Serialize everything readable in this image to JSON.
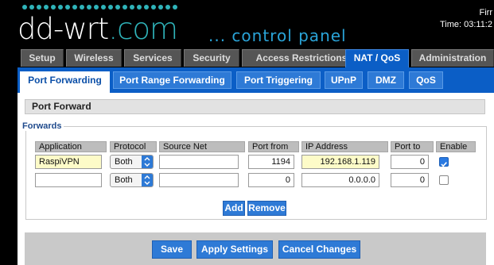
{
  "header": {
    "logo_main": "dd-wrt",
    "logo_suffix": ".com",
    "subtitle": "... control panel",
    "firmware_label": "Firr",
    "time_label": "Time: 03:11:2"
  },
  "colors": {
    "accent": "#0b5ec6",
    "header_bg": "#000000",
    "dot_teal": "#2fb3b9",
    "highlight_input": "#fdfbc8"
  },
  "main_tabs": [
    {
      "label": "Setup"
    },
    {
      "label": "Wireless"
    },
    {
      "label": "Services"
    },
    {
      "label": "Security"
    },
    {
      "label": "Access Restrictions"
    },
    {
      "label": "NAT / QoS",
      "active": true
    },
    {
      "label": "Administration"
    }
  ],
  "sub_tabs": [
    {
      "label": "Port Forwarding",
      "active": true
    },
    {
      "label": "Port Range Forwarding"
    },
    {
      "label": "Port Triggering"
    },
    {
      "label": "UPnP"
    },
    {
      "label": "DMZ"
    },
    {
      "label": "QoS"
    }
  ],
  "section": {
    "title": "Port Forward",
    "legend": "Forwards"
  },
  "table": {
    "headers": [
      "Application",
      "Protocol",
      "Source Net",
      "Port from",
      "IP Address",
      "Port to",
      "Enable"
    ],
    "rows": [
      {
        "application": "RaspiVPN",
        "protocol": "Both",
        "source_net": "",
        "port_from": "1194",
        "ip_address": "192.168.1.119",
        "port_to": "0",
        "enabled": true
      },
      {
        "application": "",
        "protocol": "Both",
        "source_net": "",
        "port_from": "0",
        "ip_address": "0.0.0.0",
        "port_to": "0",
        "enabled": false
      }
    ]
  },
  "row_buttons": {
    "add": "Add",
    "remove": "Remove"
  },
  "footer_buttons": {
    "save": "Save",
    "apply": "Apply Settings",
    "cancel": "Cancel Changes"
  }
}
